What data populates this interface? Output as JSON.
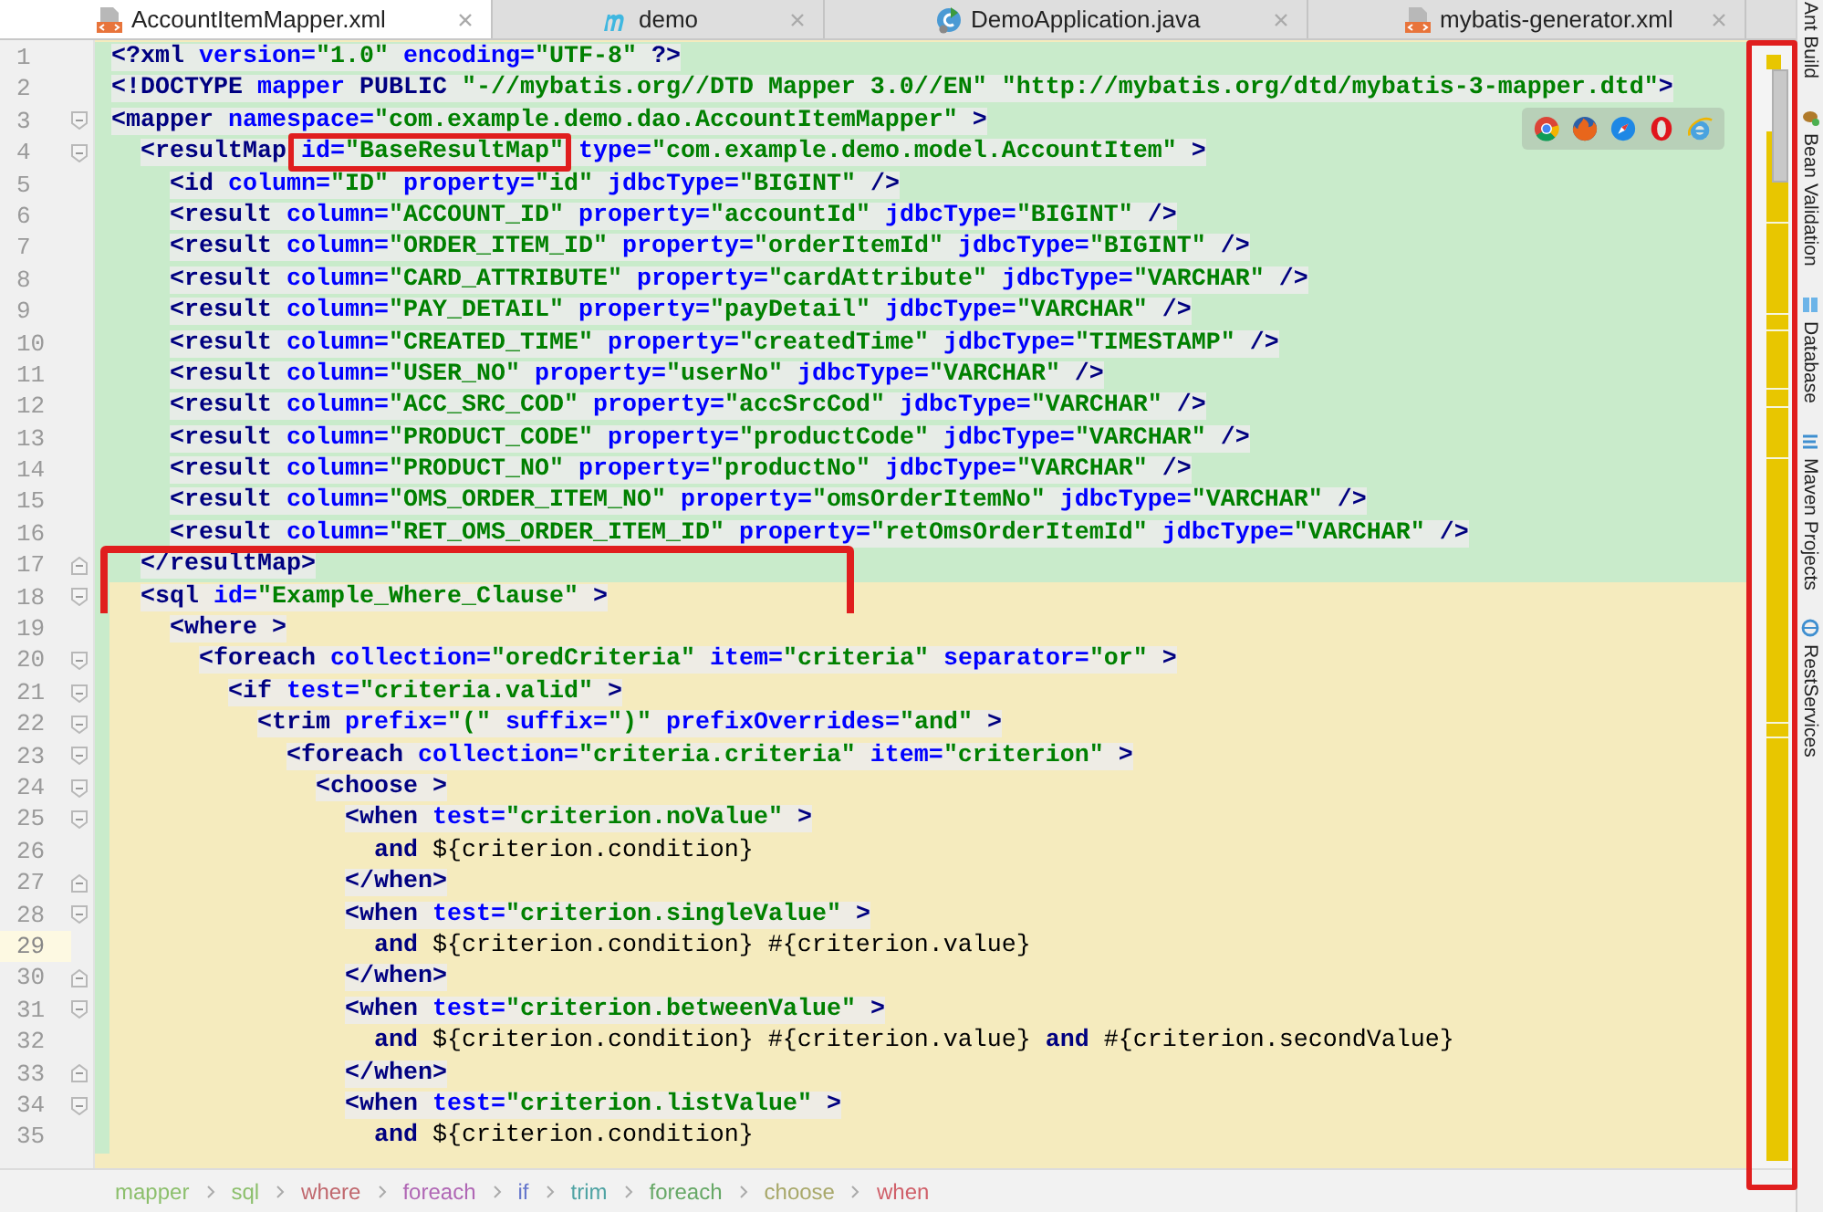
{
  "tabs": [
    {
      "label": "AccountItemMapper.xml",
      "kind": "xml",
      "selected": true
    },
    {
      "label": "demo",
      "kind": "module",
      "selected": false
    },
    {
      "label": "DemoApplication.java",
      "kind": "java",
      "selected": false
    },
    {
      "label": "mybatis-generator.xml",
      "kind": "xml",
      "selected": false
    }
  ],
  "lines": [
    {
      "number": "1",
      "kind": "added",
      "tokens": [
        {
          "kind": "tag",
          "text": "<?xml"
        },
        {
          "kind": "attr",
          "text": " version="
        },
        {
          "kind": "value",
          "text": "\"1.0\""
        },
        {
          "kind": "attr",
          "text": " encoding="
        },
        {
          "kind": "value",
          "text": "\"UTF-8\""
        },
        {
          "kind": "tag",
          "text": " ?>"
        }
      ]
    },
    {
      "number": "2",
      "kind": "added",
      "tokens": [
        {
          "kind": "tag",
          "text": "<!DOCTYPE"
        },
        {
          "kind": "attr",
          "text": " mapper"
        },
        {
          "kind": "tag",
          "text": " PUBLIC"
        },
        {
          "kind": "value",
          "text": " \"-//mybatis.org//DTD Mapper 3.0//EN\""
        },
        {
          "kind": "value",
          "text": " \"http://mybatis.org/dtd/mybatis-3-mapper.dtd\""
        },
        {
          "kind": "tag",
          "text": ">"
        }
      ]
    },
    {
      "number": "3",
      "kind": "added",
      "fold_start": true,
      "tokens": [
        {
          "kind": "tag",
          "text": "<mapper"
        },
        {
          "kind": "attr",
          "text": " namespace="
        },
        {
          "kind": "value",
          "text": "\"com.example.demo.dao.AccountItemMapper\""
        },
        {
          "kind": "tag",
          "text": " >"
        }
      ]
    },
    {
      "number": "4",
      "kind": "added",
      "fold_start": true,
      "tokens": [
        {
          "kind": "tag",
          "text": "  <resultMap"
        },
        {
          "kind": "attr",
          "text": " id=",
          "boxed": true
        },
        {
          "kind": "value",
          "text": "\"BaseResultMap\"",
          "boxed": true
        },
        {
          "kind": "attr",
          "text": " type="
        },
        {
          "kind": "value",
          "text": "\"com.example.demo.model.AccountItem\""
        },
        {
          "kind": "tag",
          "text": " >"
        }
      ]
    },
    {
      "number": "5",
      "kind": "added",
      "tokens": [
        {
          "kind": "tag",
          "text": "    <id"
        },
        {
          "kind": "attr",
          "text": " column="
        },
        {
          "kind": "value",
          "text": "\"ID\""
        },
        {
          "kind": "attr",
          "text": " property="
        },
        {
          "kind": "value",
          "text": "\"id\""
        },
        {
          "kind": "attr",
          "text": " jdbcType="
        },
        {
          "kind": "value",
          "text": "\"BIGINT\""
        },
        {
          "kind": "tag",
          "text": " />"
        }
      ]
    },
    {
      "number": "6",
      "kind": "added",
      "tokens": [
        {
          "kind": "tag",
          "text": "    <result"
        },
        {
          "kind": "attr",
          "text": " column="
        },
        {
          "kind": "value",
          "text": "\"ACCOUNT_ID\""
        },
        {
          "kind": "attr",
          "text": " property="
        },
        {
          "kind": "value",
          "text": "\"accountId\""
        },
        {
          "kind": "attr",
          "text": " jdbcType="
        },
        {
          "kind": "value",
          "text": "\"BIGINT\""
        },
        {
          "kind": "tag",
          "text": " />"
        }
      ]
    },
    {
      "number": "7",
      "kind": "added",
      "tokens": [
        {
          "kind": "tag",
          "text": "    <result"
        },
        {
          "kind": "attr",
          "text": " column="
        },
        {
          "kind": "value",
          "text": "\"ORDER_ITEM_ID\""
        },
        {
          "kind": "attr",
          "text": " property="
        },
        {
          "kind": "value",
          "text": "\"orderItemId\""
        },
        {
          "kind": "attr",
          "text": " jdbcType="
        },
        {
          "kind": "value",
          "text": "\"BIGINT\""
        },
        {
          "kind": "tag",
          "text": " />"
        }
      ]
    },
    {
      "number": "8",
      "kind": "added",
      "tokens": [
        {
          "kind": "tag",
          "text": "    <result"
        },
        {
          "kind": "attr",
          "text": " column="
        },
        {
          "kind": "value",
          "text": "\"CARD_ATTRIBUTE\""
        },
        {
          "kind": "attr",
          "text": " property="
        },
        {
          "kind": "value",
          "text": "\"cardAttribute\""
        },
        {
          "kind": "attr",
          "text": " jdbcType="
        },
        {
          "kind": "value",
          "text": "\"VARCHAR\""
        },
        {
          "kind": "tag",
          "text": " />"
        }
      ]
    },
    {
      "number": "9",
      "kind": "added",
      "tokens": [
        {
          "kind": "tag",
          "text": "    <result"
        },
        {
          "kind": "attr",
          "text": " column="
        },
        {
          "kind": "value",
          "text": "\"PAY_DETAIL\""
        },
        {
          "kind": "attr",
          "text": " property="
        },
        {
          "kind": "value",
          "text": "\"payDetail\""
        },
        {
          "kind": "attr",
          "text": " jdbcType="
        },
        {
          "kind": "value",
          "text": "\"VARCHAR\""
        },
        {
          "kind": "tag",
          "text": " />"
        }
      ]
    },
    {
      "number": "10",
      "kind": "added",
      "tokens": [
        {
          "kind": "tag",
          "text": "    <result"
        },
        {
          "kind": "attr",
          "text": " column="
        },
        {
          "kind": "value",
          "text": "\"CREATED_TIME\""
        },
        {
          "kind": "attr",
          "text": " property="
        },
        {
          "kind": "value",
          "text": "\"createdTime\""
        },
        {
          "kind": "attr",
          "text": " jdbcType="
        },
        {
          "kind": "value",
          "text": "\"TIMESTAMP\""
        },
        {
          "kind": "tag",
          "text": " />"
        }
      ]
    },
    {
      "number": "11",
      "kind": "added",
      "tokens": [
        {
          "kind": "tag",
          "text": "    <result"
        },
        {
          "kind": "attr",
          "text": " column="
        },
        {
          "kind": "value",
          "text": "\"USER_NO\""
        },
        {
          "kind": "attr",
          "text": " property="
        },
        {
          "kind": "value",
          "text": "\"userNo\""
        },
        {
          "kind": "attr",
          "text": " jdbcType="
        },
        {
          "kind": "value",
          "text": "\"VARCHAR\""
        },
        {
          "kind": "tag",
          "text": " />"
        }
      ]
    },
    {
      "number": "12",
      "kind": "added",
      "tokens": [
        {
          "kind": "tag",
          "text": "    <result"
        },
        {
          "kind": "attr",
          "text": " column="
        },
        {
          "kind": "value",
          "text": "\"ACC_SRC_COD\""
        },
        {
          "kind": "attr",
          "text": " property="
        },
        {
          "kind": "value",
          "text": "\"accSrcCod\""
        },
        {
          "kind": "attr",
          "text": " jdbcType="
        },
        {
          "kind": "value",
          "text": "\"VARCHAR\""
        },
        {
          "kind": "tag",
          "text": " />"
        }
      ]
    },
    {
      "number": "13",
      "kind": "added",
      "tokens": [
        {
          "kind": "tag",
          "text": "    <result"
        },
        {
          "kind": "attr",
          "text": " column="
        },
        {
          "kind": "value",
          "text": "\"PRODUCT_CODE\""
        },
        {
          "kind": "attr",
          "text": " property="
        },
        {
          "kind": "value",
          "text": "\"productCode\""
        },
        {
          "kind": "attr",
          "text": " jdbcType="
        },
        {
          "kind": "value",
          "text": "\"VARCHAR\""
        },
        {
          "kind": "tag",
          "text": " />"
        }
      ]
    },
    {
      "number": "14",
      "kind": "added",
      "tokens": [
        {
          "kind": "tag",
          "text": "    <result"
        },
        {
          "kind": "attr",
          "text": " column="
        },
        {
          "kind": "value",
          "text": "\"PRODUCT_NO\""
        },
        {
          "kind": "attr",
          "text": " property="
        },
        {
          "kind": "value",
          "text": "\"productNo\""
        },
        {
          "kind": "attr",
          "text": " jdbcType="
        },
        {
          "kind": "value",
          "text": "\"VARCHAR\""
        },
        {
          "kind": "tag",
          "text": " />"
        }
      ]
    },
    {
      "number": "15",
      "kind": "added",
      "tokens": [
        {
          "kind": "tag",
          "text": "    <result"
        },
        {
          "kind": "attr",
          "text": " column="
        },
        {
          "kind": "value",
          "text": "\"OMS_ORDER_ITEM_NO\""
        },
        {
          "kind": "attr",
          "text": " property="
        },
        {
          "kind": "value",
          "text": "\"omsOrderItemNo\""
        },
        {
          "kind": "attr",
          "text": " jdbcType="
        },
        {
          "kind": "value",
          "text": "\"VARCHAR\""
        },
        {
          "kind": "tag",
          "text": " />"
        }
      ]
    },
    {
      "number": "16",
      "kind": "added",
      "tokens": [
        {
          "kind": "tag",
          "text": "    <result"
        },
        {
          "kind": "attr",
          "text": " column="
        },
        {
          "kind": "value",
          "text": "\"RET_OMS_ORDER_ITEM_ID\""
        },
        {
          "kind": "attr",
          "text": " property="
        },
        {
          "kind": "value",
          "text": "\"retOmsOrderItemId\""
        },
        {
          "kind": "attr",
          "text": " jdbcType="
        },
        {
          "kind": "value",
          "text": "\"VARCHAR\""
        },
        {
          "kind": "tag",
          "text": " />"
        }
      ]
    },
    {
      "number": "17",
      "kind": "added",
      "fold_end": true,
      "boxed": true,
      "tokens": [
        {
          "kind": "tag",
          "text": "  </resultMap>"
        }
      ]
    },
    {
      "number": "18",
      "kind": "modified",
      "fold_start": true,
      "boxed": true,
      "tokens": [
        {
          "kind": "tag",
          "text": "  <sql"
        },
        {
          "kind": "attr",
          "text": " id="
        },
        {
          "kind": "value",
          "text": "\"Example_Where_Clause\""
        },
        {
          "kind": "tag",
          "text": " >"
        }
      ]
    },
    {
      "number": "19",
      "kind": "modified",
      "tokens": [
        {
          "kind": "tag",
          "text": "    <where >"
        }
      ]
    },
    {
      "number": "20",
      "kind": "modified",
      "fold_start": true,
      "tokens": [
        {
          "kind": "tag",
          "text": "      <foreach"
        },
        {
          "kind": "attr",
          "text": " collection="
        },
        {
          "kind": "value",
          "text": "\"oredCriteria\""
        },
        {
          "kind": "attr",
          "text": " item="
        },
        {
          "kind": "value",
          "text": "\"criteria\""
        },
        {
          "kind": "attr",
          "text": " separator="
        },
        {
          "kind": "value",
          "text": "\"or\""
        },
        {
          "kind": "tag",
          "text": " >"
        }
      ]
    },
    {
      "number": "21",
      "kind": "modified",
      "fold_start": true,
      "tokens": [
        {
          "kind": "tag",
          "text": "        <if"
        },
        {
          "kind": "attr",
          "text": " test="
        },
        {
          "kind": "value",
          "text": "\"criteria.valid\""
        },
        {
          "kind": "tag",
          "text": " >"
        }
      ]
    },
    {
      "number": "22",
      "kind": "modified",
      "fold_start": true,
      "tokens": [
        {
          "kind": "tag",
          "text": "          <trim"
        },
        {
          "kind": "attr",
          "text": " prefix="
        },
        {
          "kind": "value",
          "text": "\"(\""
        },
        {
          "kind": "attr",
          "text": " suffix="
        },
        {
          "kind": "value",
          "text": "\")\""
        },
        {
          "kind": "attr",
          "text": " prefixOverrides="
        },
        {
          "kind": "value",
          "text": "\"and\""
        },
        {
          "kind": "tag",
          "text": " >"
        }
      ]
    },
    {
      "number": "23",
      "kind": "modified",
      "fold_start": true,
      "tokens": [
        {
          "kind": "tag",
          "text": "            <foreach"
        },
        {
          "kind": "attr",
          "text": " collection="
        },
        {
          "kind": "value",
          "text": "\"criteria.criteria\""
        },
        {
          "kind": "attr",
          "text": " item="
        },
        {
          "kind": "value",
          "text": "\"criterion\""
        },
        {
          "kind": "tag",
          "text": " >"
        }
      ]
    },
    {
      "number": "24",
      "kind": "modified",
      "fold_start": true,
      "tokens": [
        {
          "kind": "tag",
          "text": "              <choose >"
        }
      ]
    },
    {
      "number": "25",
      "kind": "modified",
      "fold_start": true,
      "tokens": [
        {
          "kind": "tag",
          "text": "                <when"
        },
        {
          "kind": "attr",
          "text": " test="
        },
        {
          "kind": "value",
          "text": "\"criterion.noValue\""
        },
        {
          "kind": "tag",
          "text": " >"
        }
      ]
    },
    {
      "number": "26",
      "kind": "modified",
      "tokens": [
        {
          "kind": "keyword",
          "text": "                  and"
        },
        {
          "kind": "plain",
          "text": " ${criterion.condition}"
        }
      ]
    },
    {
      "number": "27",
      "kind": "modified",
      "fold_end": true,
      "tokens": [
        {
          "kind": "tag",
          "text": "                </when>"
        }
      ]
    },
    {
      "number": "28",
      "kind": "modified",
      "fold_start": true,
      "tokens": [
        {
          "kind": "tag",
          "text": "                <when"
        },
        {
          "kind": "attr",
          "text": " test="
        },
        {
          "kind": "value",
          "text": "\"criterion.singleValue\""
        },
        {
          "kind": "tag",
          "text": " >"
        }
      ]
    },
    {
      "number": "29",
      "kind": "modified",
      "current": true,
      "tokens": [
        {
          "kind": "keyword",
          "text": "                  and"
        },
        {
          "kind": "plain",
          "text": " ${criterion.condition} #{criterion.value}"
        }
      ]
    },
    {
      "number": "30",
      "kind": "modified",
      "fold_end": true,
      "tokens": [
        {
          "kind": "tag",
          "text": "                </when>"
        }
      ]
    },
    {
      "number": "31",
      "kind": "modified",
      "fold_start": true,
      "tokens": [
        {
          "kind": "tag",
          "text": "                <when"
        },
        {
          "kind": "attr",
          "text": " test="
        },
        {
          "kind": "value",
          "text": "\"criterion.betweenValue\""
        },
        {
          "kind": "tag",
          "text": " >"
        }
      ]
    },
    {
      "number": "32",
      "kind": "modified",
      "tokens": [
        {
          "kind": "keyword",
          "text": "                  and"
        },
        {
          "kind": "plain",
          "text": " ${criterion.condition} #{criterion.value} "
        },
        {
          "kind": "keyword",
          "text": "and"
        },
        {
          "kind": "plain",
          "text": " #{criterion.secondValue}"
        }
      ]
    },
    {
      "number": "33",
      "kind": "modified",
      "fold_end": true,
      "tokens": [
        {
          "kind": "tag",
          "text": "                </when>"
        }
      ]
    },
    {
      "number": "34",
      "kind": "modified",
      "fold_start": true,
      "tokens": [
        {
          "kind": "tag",
          "text": "                <when"
        },
        {
          "kind": "attr",
          "text": " test="
        },
        {
          "kind": "value",
          "text": "\"criterion.listValue\""
        },
        {
          "kind": "tag",
          "text": " >"
        }
      ]
    },
    {
      "number": "35",
      "kind": "modified",
      "tokens": [
        {
          "kind": "keyword",
          "text": "                  and"
        },
        {
          "kind": "plain",
          "text": " ${criterion.condition}"
        }
      ]
    }
  ],
  "error_stripe": {
    "highlighted": true
  },
  "tool_windows": [
    {
      "label": "Ant Build"
    },
    {
      "label": "Bean Validation",
      "kind": "bean"
    },
    {
      "label": "Database",
      "kind": "database"
    },
    {
      "label": "Maven Projects",
      "kind": "maven"
    },
    {
      "label": "RestServices",
      "kind": "rest"
    }
  ],
  "breadcrumbs": [
    {
      "label": "mapper",
      "color": "#8cbf6c"
    },
    {
      "label": "sql",
      "color": "#8cbf6c"
    },
    {
      "label": "where",
      "color": "#c0686e"
    },
    {
      "label": "foreach",
      "color": "#b067b5"
    },
    {
      "label": "if",
      "color": "#6677cc"
    },
    {
      "label": "trim",
      "color": "#4fa3a3"
    },
    {
      "label": "foreach",
      "color": "#66a866"
    },
    {
      "label": "choose",
      "color": "#a8a86a"
    },
    {
      "label": "when",
      "color": "#d0606a"
    }
  ]
}
